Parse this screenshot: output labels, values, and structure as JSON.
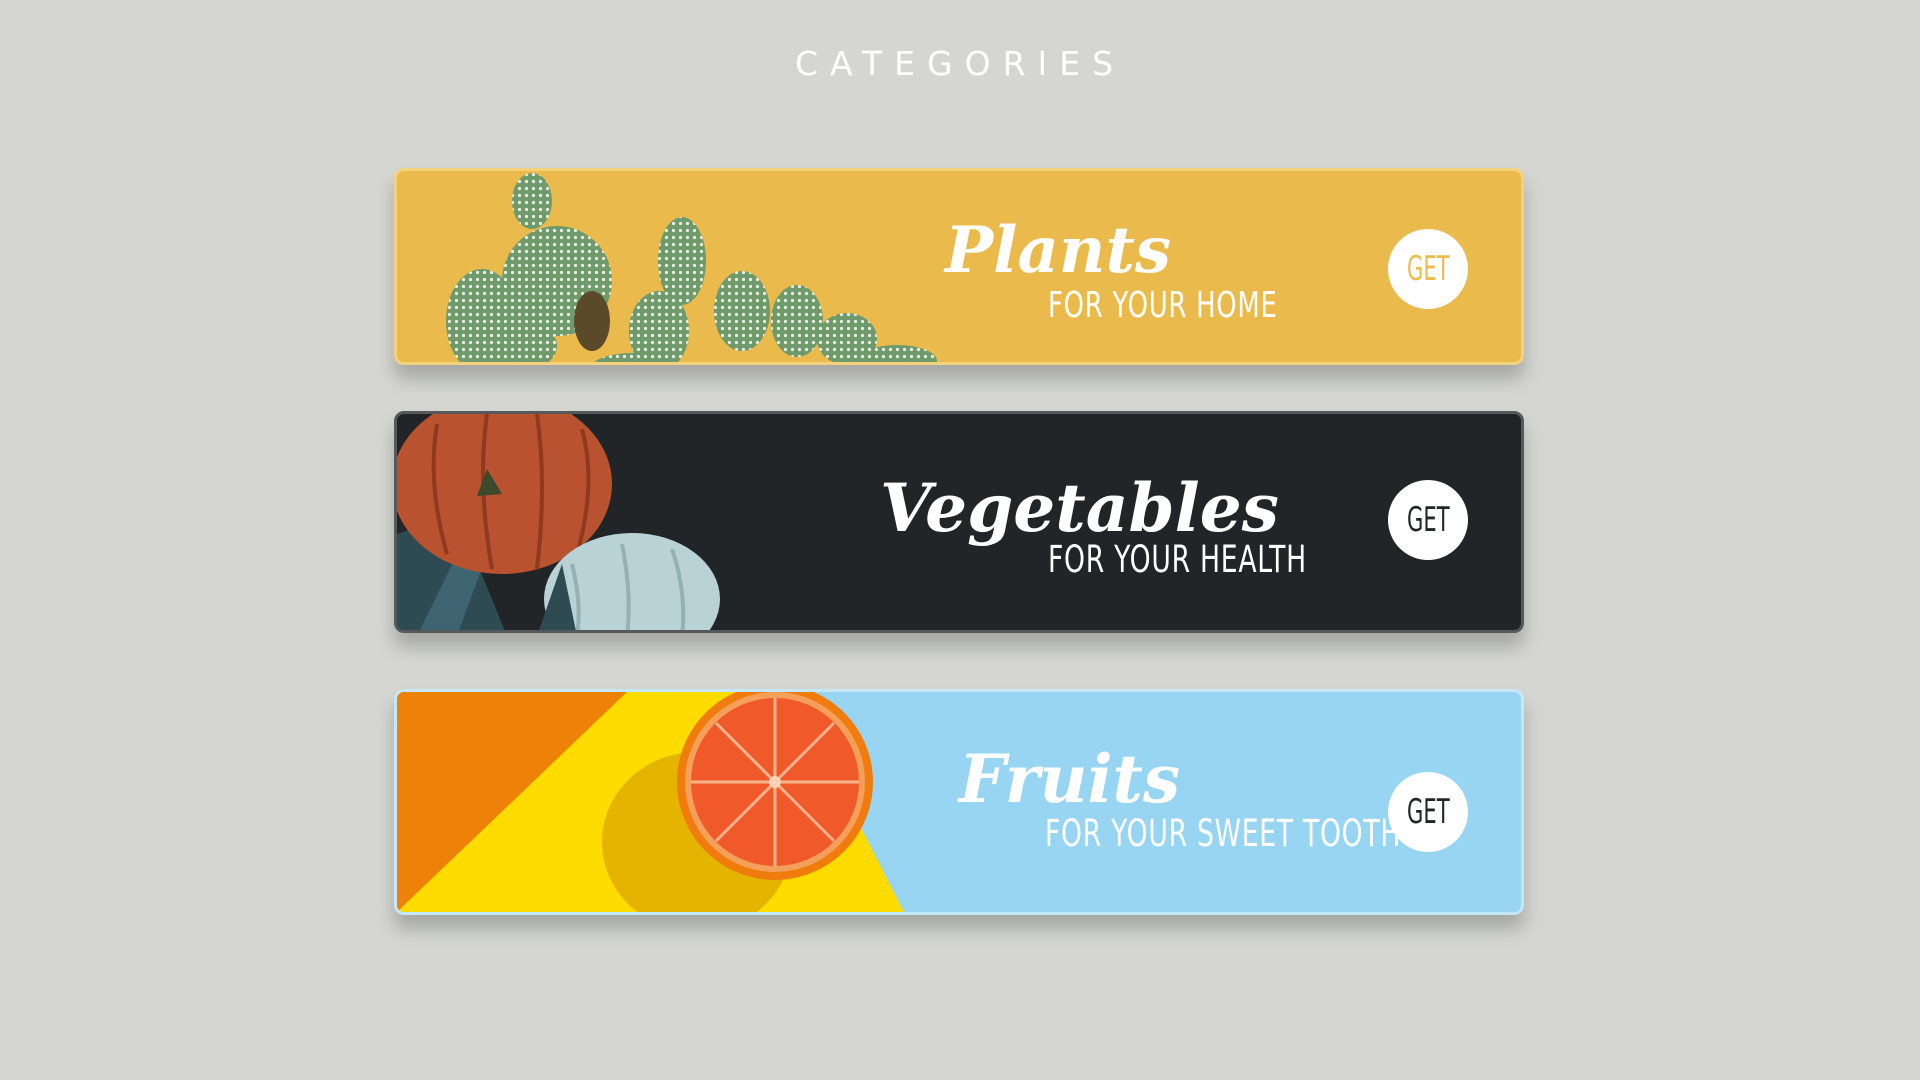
{
  "page": {
    "title": "CATEGORIES"
  },
  "categories": [
    {
      "id": "plants",
      "title": "Plants",
      "subtitle": "FOR YOUR HOME",
      "button_label": "GET",
      "image": "cactus-image",
      "button_text_color": "#eabb4c",
      "background": "#eabb4c"
    },
    {
      "id": "vegetables",
      "title": "Vegetables",
      "subtitle": "FOR YOUR HEALTH",
      "button_label": "GET",
      "image": "pumpkin-image",
      "button_text_color": "#212528",
      "background": "#212528"
    },
    {
      "id": "fruits",
      "title": "Fruits",
      "subtitle": "FOR YOUR SWEET TOOTH",
      "button_label": "GET",
      "image": "orange-image",
      "button_text_color": "#212528",
      "background": "#97d5f2"
    }
  ]
}
